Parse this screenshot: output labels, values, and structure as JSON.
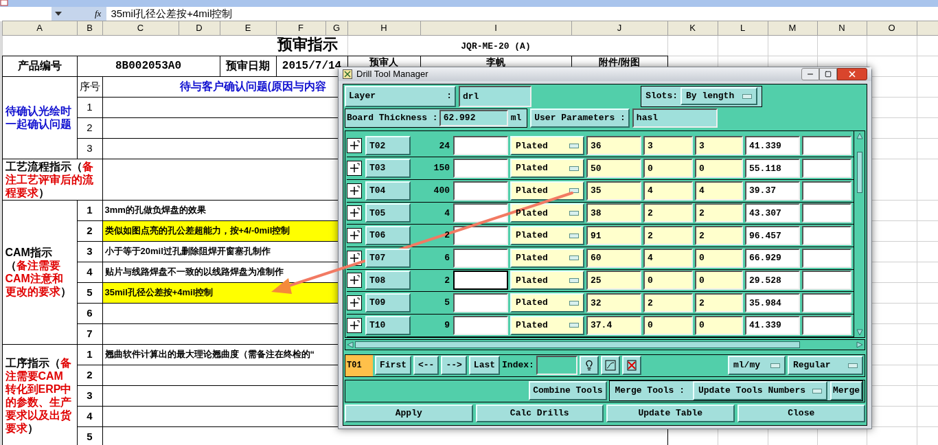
{
  "formula_bar": {
    "function_symbol": "fx",
    "formula": "35mil孔径公差按+4mil控制"
  },
  "column_headers": [
    "A",
    "B",
    "C",
    "D",
    "E",
    "F",
    "G",
    "H",
    "I",
    "J",
    "K",
    "L",
    "M",
    "N",
    "O"
  ],
  "sheet": {
    "title": "预审指示",
    "doc_code": "JQR-ME-20 (A)",
    "info": {
      "product_label": "产品编号",
      "product_no": "8B002053A0",
      "date_label": "预审日期",
      "date": "2015/7/14",
      "reviewer_label": "预审人",
      "reviewer": "李帆",
      "attachment_label": "附件/附图"
    },
    "sections": [
      {
        "kind": "confirm",
        "label": "待确认光绘时一起确认问题",
        "no_label": "序号",
        "header": "待与客户确认问题(原因与内容",
        "rows": [
          {
            "no": "1",
            "highlighted": false
          },
          {
            "no": "2",
            "highlighted": false
          },
          {
            "no": "3",
            "highlighted": false
          }
        ]
      },
      {
        "kind": "process",
        "label": "工艺流程指示（",
        "note": "备注工艺评审后的流程要求",
        "close": "）"
      },
      {
        "kind": "items",
        "label": "CAM指示（",
        "note": "备注需要CAM注意和更改的要求",
        "close": "）",
        "rows": [
          {
            "no": "1",
            "text": "3mm的孔做负焊盘的效果",
            "highlighted": false
          },
          {
            "no": "2",
            "text": "类似如图点亮的孔公差超能力，按+4/-0mil控制",
            "highlighted": true
          },
          {
            "no": "3",
            "text": "小于等于20mil过孔删除阻焊开窗塞孔制作",
            "highlighted": false
          },
          {
            "no": "4",
            "text": "贴片与线路焊盘不一致的以线路焊盘为准制作",
            "highlighted": false
          },
          {
            "no": "5",
            "text": "35mil孔径公差按+4mil控制",
            "highlighted": true
          },
          {
            "no": "6",
            "highlighted": false
          },
          {
            "no": "7",
            "highlighted": false
          }
        ]
      },
      {
        "kind": "items",
        "label": "工序指示（",
        "note": "备注需要CAM转化到ERP中的参数、生产要求以及出货要求",
        "close": "）",
        "rows": [
          {
            "no": "1",
            "text": "翘曲软件计算出的最大理论翘曲度（需备注在终检的“",
            "highlighted": false
          },
          {
            "no": "2",
            "highlighted": false
          },
          {
            "no": "3",
            "highlighted": false
          },
          {
            "no": "4",
            "highlighted": false
          },
          {
            "no": "5",
            "highlighted": false
          }
        ]
      }
    ]
  },
  "dialog": {
    "title": "Drill Tool Manager",
    "layer_label": "Layer",
    "layer_colon": ":",
    "layer": "drl",
    "slots_label": "Slots:",
    "slots": "By length",
    "thickness_label": "Board Thickness :",
    "thickness": "62.992",
    "thickness_unit": "ml",
    "user_params_label": "User Parameters :",
    "user_params": "hasl",
    "tools": [
      {
        "name": "T02",
        "count": "24",
        "plating": "Plated",
        "col_6": "36",
        "col_7": "3",
        "col_8": "3",
        "col_9": "41.339",
        "focused": false
      },
      {
        "name": "T03",
        "count": "150",
        "plating": "Plated",
        "col_6": "50",
        "col_7": "0",
        "col_8": "0",
        "col_9": "55.118",
        "focused": false
      },
      {
        "name": "T04",
        "count": "400",
        "plating": "Plated",
        "col_6": "35",
        "col_7": "4",
        "col_8": "4",
        "col_9": "39.37",
        "focused": false
      },
      {
        "name": "T05",
        "count": "4",
        "plating": "Plated",
        "col_6": "38",
        "col_7": "2",
        "col_8": "2",
        "col_9": "43.307",
        "focused": false
      },
      {
        "name": "T06",
        "count": "2",
        "plating": "Plated",
        "col_6": "91",
        "col_7": "2",
        "col_8": "2",
        "col_9": "96.457",
        "focused": false
      },
      {
        "name": "T07",
        "count": "6",
        "plating": "Plated",
        "col_6": "60",
        "col_7": "4",
        "col_8": "0",
        "col_9": "66.929",
        "focused": false
      },
      {
        "name": "T08",
        "count": "2",
        "plating": "Plated",
        "col_6": "25",
        "col_7": "0",
        "col_8": "0",
        "col_9": "29.528",
        "focused": true
      },
      {
        "name": "T09",
        "count": "5",
        "plating": "Plated",
        "col_6": "32",
        "col_7": "2",
        "col_8": "2",
        "col_9": "35.984",
        "focused": false
      },
      {
        "name": "T10",
        "count": "9",
        "plating": "Plated",
        "col_6": "37.4",
        "col_7": "0",
        "col_8": "0",
        "col_9": "41.339",
        "focused": false
      }
    ],
    "current_tool": "T01",
    "nav_buttons": [
      "First",
      "<--",
      "-->",
      "Last"
    ],
    "index_label": "Index:",
    "units": "ml/my",
    "mode": "Regular",
    "combine": "Combine Tools",
    "merge_label": "Merge Tools :",
    "merge_option": "Update Tools Numbers",
    "merge": "Merge",
    "actions": [
      "Apply",
      "Calc Drills",
      "Update Table",
      "Close"
    ]
  }
}
